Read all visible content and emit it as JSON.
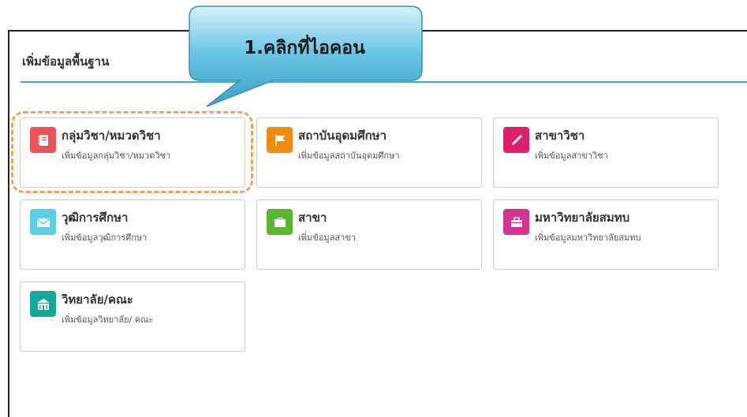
{
  "panel": {
    "title": "เพิ่มข้อมูลพื้นฐาน"
  },
  "callout": {
    "text": "1.คลิกที่ไอคอน"
  },
  "cards": [
    {
      "title": "กลุ่มวิชา/หมวดวิชา",
      "subtitle": "เพิ่มข้อมูลกลุ่มวิชา/หมวดวิชา",
      "icon": "notebook-icon",
      "color": "#e8545a"
    },
    {
      "title": "สถาบันอุดมศึกษา",
      "subtitle": "เพิ่มข้อมูลสถาบันอุดมศึกษา",
      "icon": "flag-icon",
      "color": "#f28c0f"
    },
    {
      "title": "สาขาวิชา",
      "subtitle": "เพิ่มข้อมูลสาขาวิชา",
      "icon": "pen-icon",
      "color": "#dc1f6b"
    },
    {
      "title": "วุฒิการศึกษา",
      "subtitle": "เพิ่มข้อมูลวุฒิการศึกษา",
      "icon": "envelope-icon",
      "color": "#5ccfe6"
    },
    {
      "title": "สาขา",
      "subtitle": "เพิ่มข้อมูลสาขา",
      "icon": "folder-icon",
      "color": "#5cb531"
    },
    {
      "title": "มหาวิทยาลัยสมทบ",
      "subtitle": "เพิ่มข้อมูลมหาวิทยาลัยสมทบ",
      "icon": "briefcase-icon",
      "color": "#d4338f"
    },
    {
      "title": "วิทยาลัย/คณะ",
      "subtitle": "เพิ่มข้อมูลวิทยาลัย/ คณะ",
      "icon": "building-icon",
      "color": "#17a69a"
    }
  ]
}
